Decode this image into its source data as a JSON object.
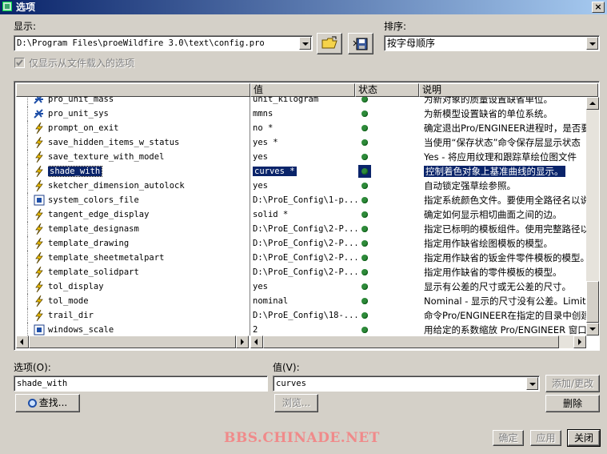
{
  "window": {
    "title": "选项",
    "close_glyph": "×"
  },
  "display": {
    "label": "显示:",
    "path_value": "D:\\Program Files\\proeWildfire 3.0\\text\\config.pro",
    "open_icon": "folder-open-icon",
    "save_icon": "save-icon"
  },
  "sort": {
    "label": "排序:",
    "value": "按字母顺序"
  },
  "checkbox": {
    "label": "仅显示从文件载入的选项",
    "checked": true
  },
  "columns": {
    "name": "",
    "value": "值",
    "status": "状态",
    "desc": "说明"
  },
  "rows": [
    {
      "name": "pro_unit_mass",
      "icon": "star-icon",
      "value": "unit_kilogram",
      "desc": "为新对象的质量设置缺省单位。"
    },
    {
      "name": "pro_unit_sys",
      "icon": "star-icon",
      "value": "mmns",
      "desc": "为新模型设置缺省的单位系统。"
    },
    {
      "name": "prompt_on_exit",
      "icon": "lightning-icon",
      "value": "no *",
      "desc": "确定退出Pro/ENGINEER进程时，是否要求保存"
    },
    {
      "name": "save_hidden_items_w_status",
      "icon": "lightning-icon",
      "value": "yes *",
      "desc": "当使用“保存状态”命令保存层显示状态"
    },
    {
      "name": "save_texture_with_model",
      "icon": "lightning-icon",
      "value": "yes",
      "desc": "Yes - 将应用纹理和跟踪草绘位图文件"
    },
    {
      "name": "shade_with",
      "icon": "lightning-icon",
      "value": "curves *",
      "desc": "控制着色对象上基准曲线的显示。",
      "selected": true
    },
    {
      "name": "sketcher_dimension_autolock",
      "icon": "lightning-icon",
      "value": "yes",
      "desc": "自动锁定强草绘参照。"
    },
    {
      "name": "system_colors_file",
      "icon": "file-icon",
      "value": "D:\\ProE_Config\\1-p...",
      "desc": "指定系统颜色文件。要使用全路径名以说"
    },
    {
      "name": "tangent_edge_display",
      "icon": "lightning-icon",
      "value": "solid *",
      "desc": "确定如何显示相切曲面之间的边。"
    },
    {
      "name": "template_designasm",
      "icon": "lightning-icon",
      "value": "D:\\ProE_Config\\2-P...",
      "desc": "指定已标明的模板组件。使用完整路径以"
    },
    {
      "name": "template_drawing",
      "icon": "lightning-icon",
      "value": "D:\\ProE_Config\\2-P...",
      "desc": "指定用作缺省绘图模板的模型。"
    },
    {
      "name": "template_sheetmetalpart",
      "icon": "lightning-icon",
      "value": "D:\\ProE_Config\\2-P...",
      "desc": "指定用作缺省的钣金件零件模板的模型。"
    },
    {
      "name": "template_solidpart",
      "icon": "lightning-icon",
      "value": "D:\\ProE_Config\\2-P...",
      "desc": "指定用作缺省的零件模板的模型。"
    },
    {
      "name": "tol_display",
      "icon": "lightning-icon",
      "value": "yes",
      "desc": "显示有公差的尺寸或无公差的尺寸。"
    },
    {
      "name": "tol_mode",
      "icon": "lightning-icon",
      "value": "nominal",
      "desc": "Nominal - 显示的尺寸没有公差。Limits"
    },
    {
      "name": "trail_dir",
      "icon": "lightning-icon",
      "value": "D:\\ProE_Config\\18-...",
      "desc": "命令Pro/ENGINEER在指定的目录中创建跟"
    },
    {
      "name": "windows_scale",
      "icon": "file-icon",
      "value": "2",
      "desc": "用给定的系数缩放 Pro/ENGINEER 窗口。"
    }
  ],
  "option_field": {
    "label": "选项(O):",
    "value": "shade_with"
  },
  "value_field": {
    "label": "值(V):",
    "value": "curves"
  },
  "buttons": {
    "find": "查找...",
    "browse": "浏览...",
    "add_change": "添加/更改",
    "delete": "删除",
    "ok": "确定",
    "apply": "应用",
    "close": "关闭"
  },
  "watermark": "BBS.CHINADE.NET",
  "colors": {
    "title_start": "#0a246a",
    "selection": "#0a246a",
    "status_dot": "#2e8b3a",
    "watermark": "#f08a8a"
  }
}
